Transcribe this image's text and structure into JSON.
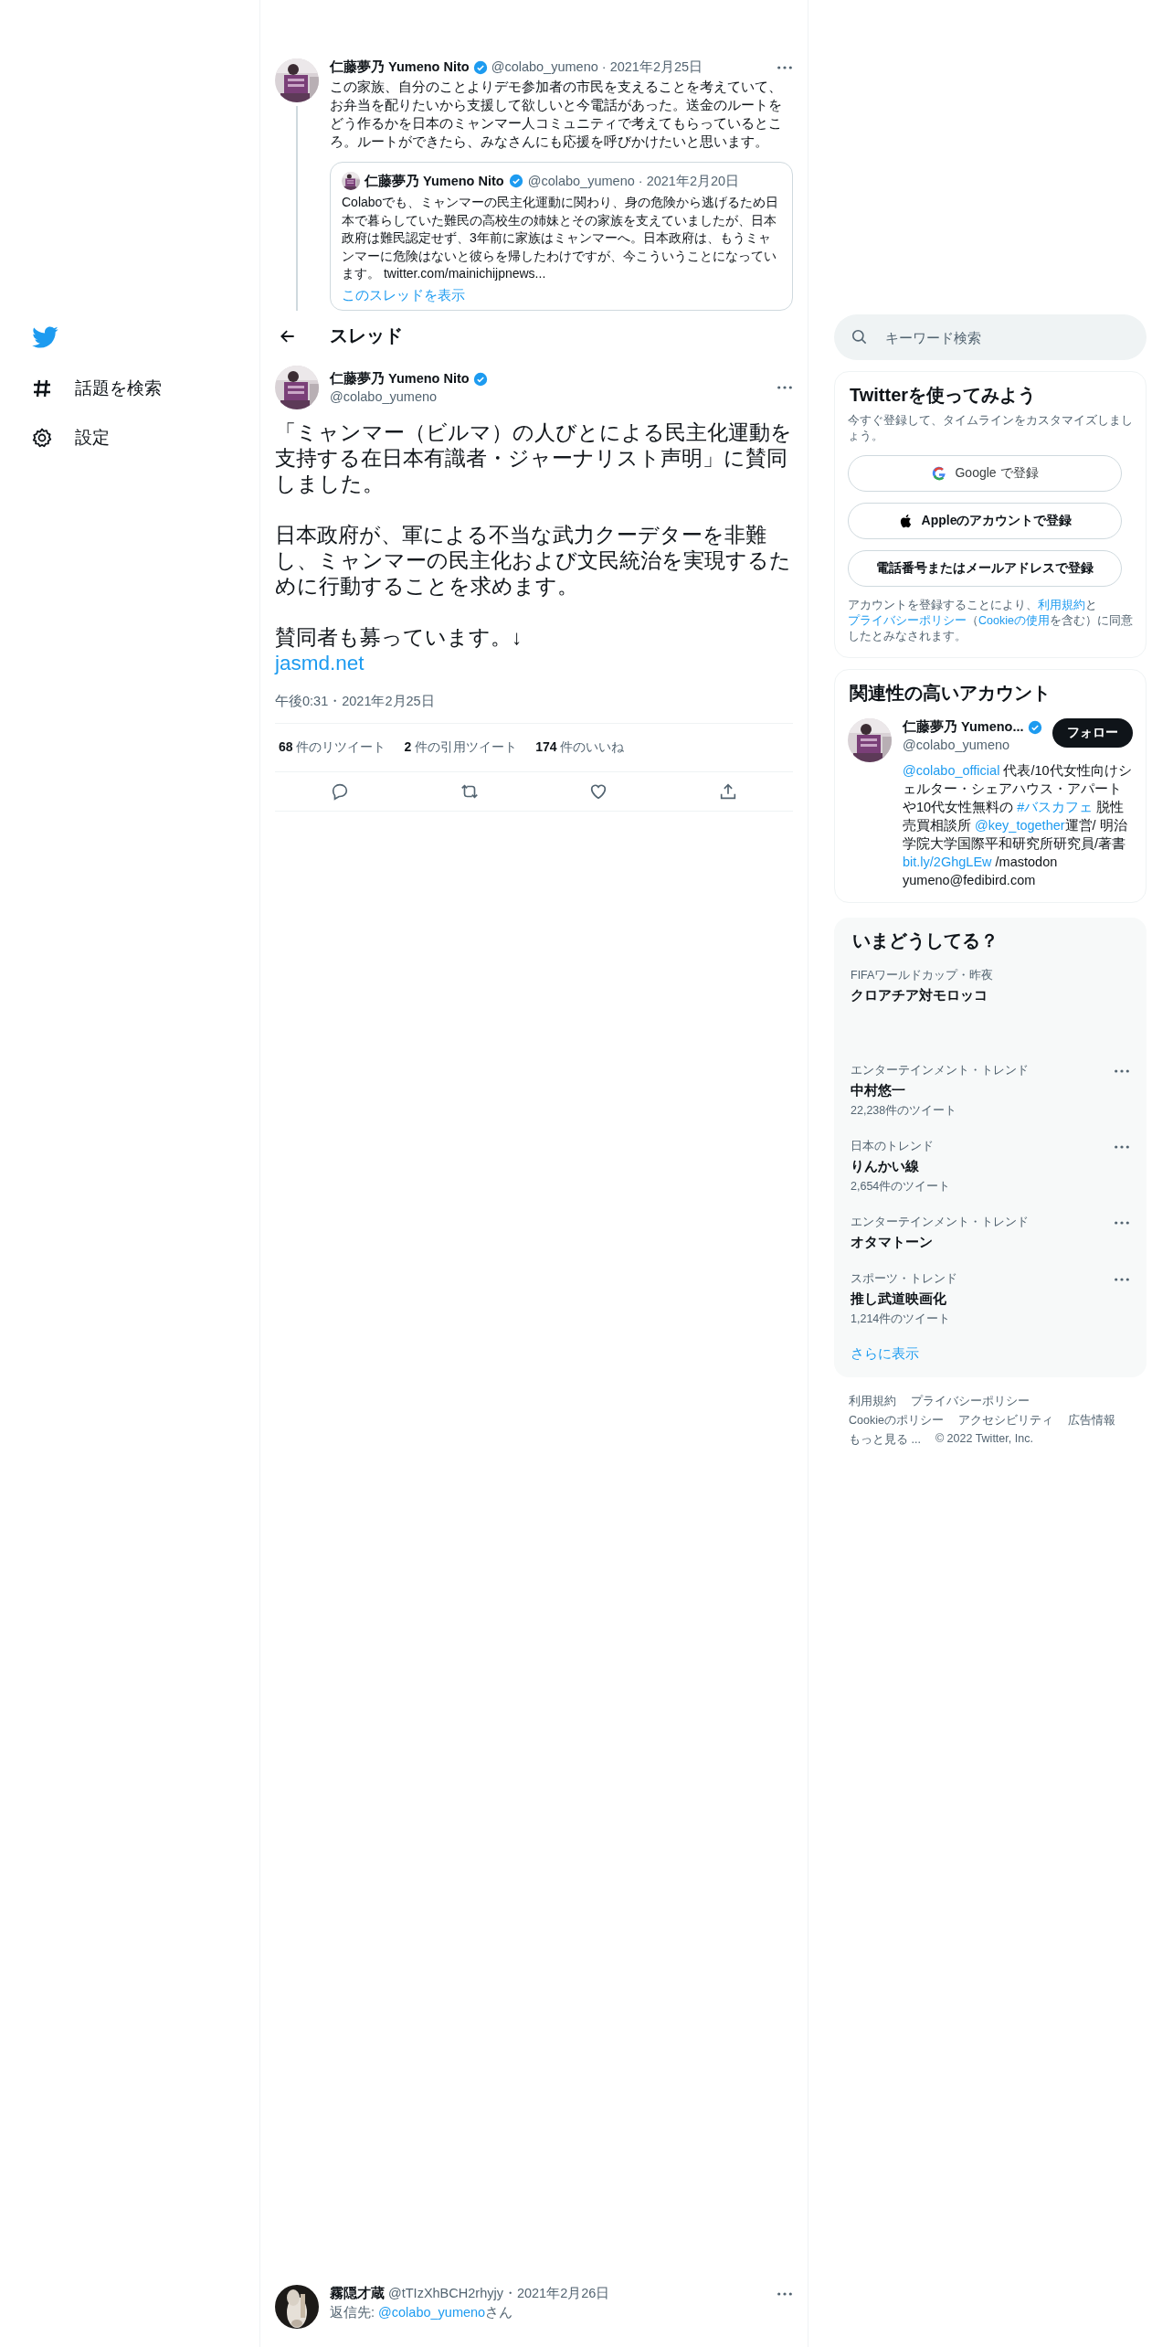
{
  "sidebar": {
    "items": [
      {
        "kind": "explore",
        "label": "話題を検索"
      },
      {
        "kind": "settings",
        "label": "設定"
      }
    ]
  },
  "thread_tweet": {
    "name": "仁藤夢乃 Yumeno Nito",
    "verified": true,
    "meta": "@colabo_yumeno · 2021年2月25日",
    "text": "この家族、自分のことよりデモ参加者の市民を支えることを考えていて、お弁当を配りたいから支援して欲しいと今電話があった。送金のルートをどう作るかを日本のミャンマー人コミュニティで考えてもらっているところ。ルートができたら、みなさんにも応援を呼びかけたいと思います。",
    "quote": {
      "name": "仁藤夢乃 Yumeno Nito",
      "verified": true,
      "meta": "@colabo_yumeno · 2021年2月20日",
      "text": "Colaboでも、ミャンマーの民主化運動に関わり、身の危険から逃げるため日本で暮らしていた難民の高校生の姉妹とその家族を支えていましたが、日本政府は難民認定せず、3年前に家族はミャンマーへ。日本政府は、もうミャンマーに危険はないと彼らを帰したわけですが、今こういうことになっています。 twitter.com/mainichijpnews...",
      "show_thread": "このスレッドを表示"
    }
  },
  "header": {
    "title": "スレッド"
  },
  "main_tweet": {
    "name": "仁藤夢乃 Yumeno Nito",
    "verified": true,
    "handle": "@colabo_yumeno",
    "paragraphs": [
      "「ミャンマー（ビルマ）の人びとによる民主化運動を支持する在日本有識者・ジャーナリスト声明」に賛同しました。",
      "日本政府が、軍による不当な武力クーデターを非難し、ミャンマーの民主化および文民統治を実現するために行動することを求めます。",
      "賛同者も募っています。↓"
    ],
    "link": "jasmd.net",
    "time": "午後0:31・2021年2月25日",
    "stats": [
      "**68** 件のリツイート",
      "**2** 件の引用ツイート",
      "**174** 件のいいね"
    ],
    "actions": [
      {
        "kind": "reply"
      },
      {
        "kind": "retweet"
      },
      {
        "kind": "like"
      },
      {
        "kind": "share"
      }
    ]
  },
  "reply": {
    "name": "霧隠才蔵",
    "meta": "@tTIzXhBCH2rhyjy・2021年2月26日",
    "reply_to": [
      {
        "text": "返信先: ",
        "link": false
      },
      {
        "text": "@colabo_yumeno",
        "link": true
      },
      {
        "text": "さん",
        "link": false
      }
    ]
  },
  "search": {
    "placeholder": "キーワード検索"
  },
  "signup": {
    "title": "Twitterを使ってみよう",
    "subtitle": "今すぐ登録して、タイムラインをカスタマイズしましょう。",
    "buttons": [
      {
        "kind": "google",
        "label": "Google で登録"
      },
      {
        "kind": "apple",
        "label": "Appleのアカウントで登録"
      },
      {
        "kind": "phone",
        "label": "電話番号またはメールアドレスで登録"
      }
    ],
    "legal": [
      {
        "text": "アカウントを登録することにより、",
        "link": false
      },
      {
        "text": "利用規約",
        "link": true
      },
      {
        "text": "と",
        "link": false
      },
      {
        "text": "プライバシーポリシー",
        "link": true
      },
      {
        "text": "（",
        "link": false
      },
      {
        "text": "Cookieの使用",
        "link": true
      },
      {
        "text": "を含む）に同意したとみなされます。",
        "link": false
      }
    ]
  },
  "related": {
    "title": "関連性の高いアカウント",
    "name": "仁藤夢乃 Yumeno...",
    "verified": true,
    "handle": "@colabo_yumeno",
    "follow": "フォロー",
    "bio": [
      {
        "text": "@colabo_official",
        "link": true
      },
      {
        "text": " 代表/10代女性向けシェルター・シェアハウス・アパートや10代女性無料の ",
        "link": false
      },
      {
        "text": "#バスカフェ",
        "link": true
      },
      {
        "text": " 脱性売買相談所 ",
        "link": false
      },
      {
        "text": "@key_together",
        "link": true
      },
      {
        "text": "運営/ 明治学院大学国際平和研究所研究員/著書",
        "link": false
      },
      {
        "text": "bit.ly/2GhgLEw",
        "link": true
      },
      {
        "text": " /mastodon yumeno@fedibird.com",
        "link": false
      }
    ]
  },
  "trends": {
    "title": "いまどうしてる？",
    "items": [
      {
        "kind": "event",
        "context": "FIFAワールドカップ・昨夜",
        "title": "クロアチア対モロッコ"
      },
      {
        "kind": "trend",
        "context": "エンターテインメント・トレンド",
        "title": "中村悠一",
        "count": "22,238件のツイート"
      },
      {
        "kind": "trend",
        "context": "日本のトレンド",
        "title": "りんかい線",
        "count": "2,654件のツイート"
      },
      {
        "kind": "trend",
        "context": "エンターテインメント・トレンド",
        "title": "オタマトーン"
      },
      {
        "kind": "trend",
        "context": "スポーツ・トレンド",
        "title": "推し武道映画化",
        "count": "1,214件のツイート"
      }
    ],
    "more": "さらに表示"
  },
  "footer": {
    "links": [
      "利用規約",
      "プライバシーポリシー",
      "Cookieのポリシー",
      "アクセシビリティ",
      "広告情報",
      "もっと見る ..."
    ],
    "copyright": "© 2022 Twitter, Inc."
  }
}
